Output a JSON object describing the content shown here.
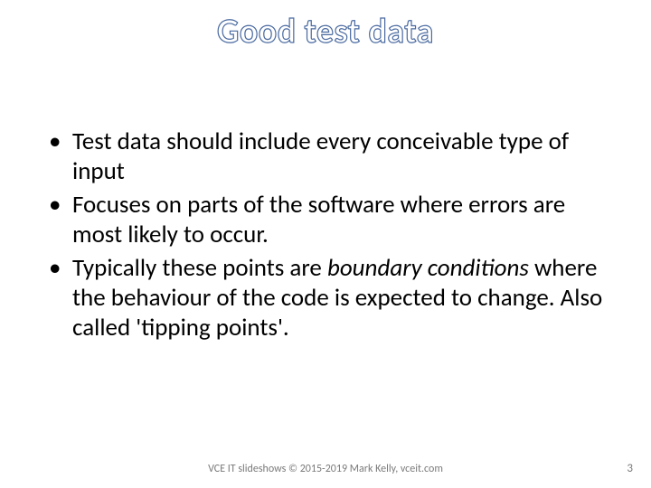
{
  "title": "Good test data",
  "bullets": [
    {
      "pre": "Test data should include every conceivable type of input",
      "em": "",
      "post": ""
    },
    {
      "pre": "Focuses on parts of the software where errors are most likely to occur.",
      "em": "",
      "post": ""
    },
    {
      "pre": "Typically these points are ",
      "em": "boundary conditions",
      "post": " where the behaviour of the code is expected to change.  Also called 'tipping points'."
    }
  ],
  "footer": "VCE IT slideshows © 2015-2019 Mark Kelly, vceit.com",
  "page_number": "3"
}
